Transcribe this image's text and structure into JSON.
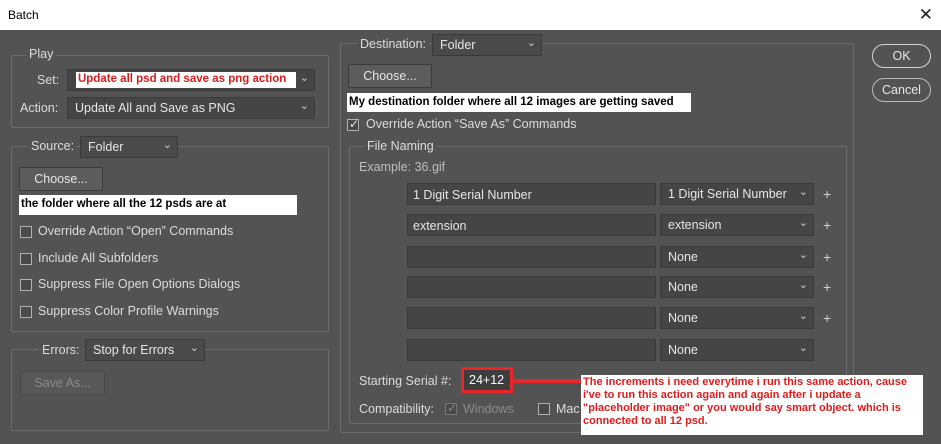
{
  "window": {
    "title": "Batch",
    "close_glyph": "✕"
  },
  "play": {
    "group_label": "Play",
    "set_label": "Set:",
    "set_value": "Update all psd and save as png action",
    "action_label": "Action:",
    "action_value": "Update All and Save as PNG"
  },
  "source": {
    "label": "Source:",
    "value": "Folder",
    "choose_label": "Choose...",
    "folder_note": "the folder where all the 12 psds are at",
    "checkboxes": [
      {
        "label": "Override Action “Open” Commands",
        "checked": false
      },
      {
        "label": "Include All Subfolders",
        "checked": false
      },
      {
        "label": "Suppress File Open Options Dialogs",
        "checked": false
      },
      {
        "label": "Suppress Color Profile Warnings",
        "checked": false
      }
    ]
  },
  "errors": {
    "label": "Errors:",
    "value": "Stop for Errors",
    "save_as_label": "Save As..."
  },
  "destination": {
    "label": "Destination:",
    "value": "Folder",
    "choose_label": "Choose...",
    "folder_note": "My destination folder where all 12 images are getting saved",
    "override_label": "Override Action “Save As” Commands",
    "override_checked": true
  },
  "file_naming": {
    "group_label": "File Naming",
    "example": "Example: 36.gif",
    "rows": [
      {
        "text": "1 Digit Serial Number",
        "select": "1 Digit Serial Number"
      },
      {
        "text": "extension",
        "select": "extension"
      },
      {
        "text": "",
        "select": "None"
      },
      {
        "text": "",
        "select": "None"
      },
      {
        "text": "",
        "select": "None"
      },
      {
        "text": "",
        "select": "None"
      }
    ],
    "plus_glyph": "+",
    "serial_label": "Starting Serial #:",
    "serial_value": "24+12",
    "compat_label": "Compatibility:",
    "windows_label": "Windows",
    "windows_checked": true,
    "mac_label": "Mac",
    "mac_checked": false
  },
  "buttons": {
    "ok": "OK",
    "cancel": "Cancel"
  },
  "annotation": {
    "text": "The increments i need everytime i run this same action, cause i've to run this action again and again after i update a \"placeholder image\" or you would say smart object. which is connected to all 12 psd.",
    "color": "#e8252b"
  },
  "icons": {
    "chevron": "chevron-down-icon",
    "close": "close-icon",
    "check": "checkmark-icon"
  }
}
